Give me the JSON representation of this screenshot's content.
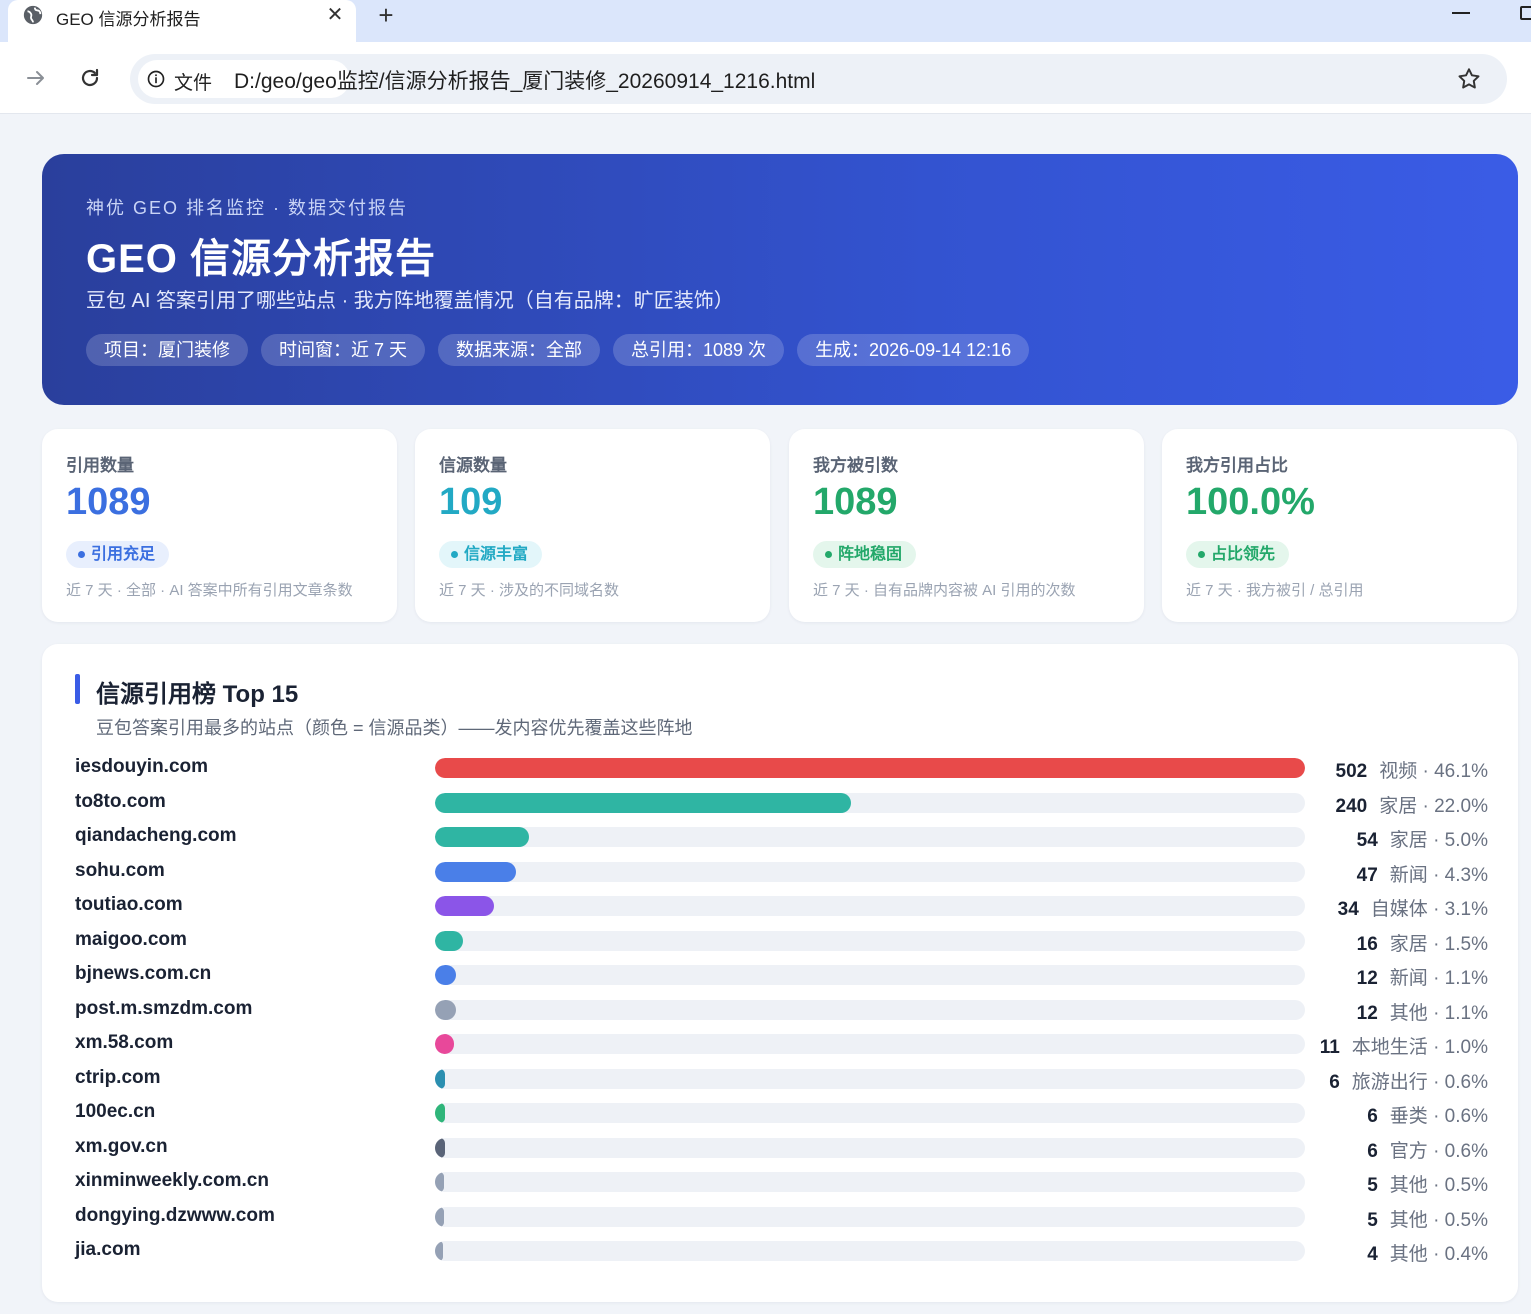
{
  "browser": {
    "tab_title": "GEO 信源分析报告",
    "chip_label": "文件",
    "url": "D:/geo/geo监控/信源分析报告_厦门装修_20260914_1216.html",
    "close_glyph": "✕",
    "newtab_glyph": "+"
  },
  "hero": {
    "eyebrow": "神优 GEO 排名监控 · 数据交付报告",
    "title": "GEO 信源分析报告",
    "subtitle": "豆包 AI 答案引用了哪些站点 · 我方阵地覆盖情况（自有品牌：旷匠装饰）",
    "pills": [
      "项目：厦门装修",
      "时间窗：近 7 天",
      "数据来源：全部",
      "总引用：1089 次",
      "生成：2026-09-14 12:16"
    ]
  },
  "kpis": [
    {
      "label": "引用数量",
      "value": "1089",
      "badge": "引用充足",
      "note": "近 7 天 · 全部 · AI 答案中所有引用文章条数",
      "color": "#3b6fe0",
      "badge_bg": "#e8effd"
    },
    {
      "label": "信源数量",
      "value": "109",
      "badge": "信源丰富",
      "note": "近 7 天 · 涉及的不同域名数",
      "color": "#22a9c4",
      "badge_bg": "#e3f6fa"
    },
    {
      "label": "我方被引数",
      "value": "1089",
      "badge": "阵地稳固",
      "note": "近 7 天 · 自有品牌内容被 AI 引用的次数",
      "color": "#23a86a",
      "badge_bg": "#e4f6ec"
    },
    {
      "label": "我方引用占比",
      "value": "100.0%",
      "badge": "占比领先",
      "note": "近 7 天 · 我方被引 / 总引用",
      "color": "#23a86a",
      "badge_bg": "#e4f6ec"
    }
  ],
  "ranking": {
    "title": "信源引用榜 Top 15",
    "subtitle": "豆包答案引用最多的站点（颜色 = 信源品类）——发内容优先覆盖这些阵地",
    "rows": [
      {
        "domain": "iesdouyin.com",
        "count": "502",
        "category": "视频 · 46.1%",
        "value": 502,
        "color": "#e84a4a"
      },
      {
        "domain": "to8to.com",
        "count": "240",
        "category": "家居 · 22.0%",
        "value": 240,
        "color": "#2fb5a3"
      },
      {
        "domain": "qiandacheng.com",
        "count": "54",
        "category": "家居 · 5.0%",
        "value": 54,
        "color": "#2fb5a3"
      },
      {
        "domain": "sohu.com",
        "count": "47",
        "category": "新闻 · 4.3%",
        "value": 47,
        "color": "#4a7fe8"
      },
      {
        "domain": "toutiao.com",
        "count": "34",
        "category": "自媒体 · 3.1%",
        "value": 34,
        "color": "#8b55e8"
      },
      {
        "domain": "maigoo.com",
        "count": "16",
        "category": "家居 · 1.5%",
        "value": 16,
        "color": "#2fb5a3"
      },
      {
        "domain": "bjnews.com.cn",
        "count": "12",
        "category": "新闻 · 1.1%",
        "value": 12,
        "color": "#4a7fe8"
      },
      {
        "domain": "post.m.smzdm.com",
        "count": "12",
        "category": "其他 · 1.1%",
        "value": 12,
        "color": "#95a1b5"
      },
      {
        "domain": "xm.58.com",
        "count": "11",
        "category": "本地生活 · 1.0%",
        "value": 11,
        "color": "#e8489a"
      },
      {
        "domain": "ctrip.com",
        "count": "6",
        "category": "旅游出行 · 0.6%",
        "value": 6,
        "color": "#2b8fb0"
      },
      {
        "domain": "100ec.cn",
        "count": "6",
        "category": "垂类 · 0.6%",
        "value": 6,
        "color": "#2fb57a"
      },
      {
        "domain": "xm.gov.cn",
        "count": "6",
        "category": "官方 · 0.6%",
        "value": 6,
        "color": "#5a6478"
      },
      {
        "domain": "xinminweekly.com.cn",
        "count": "5",
        "category": "其他 · 0.5%",
        "value": 5,
        "color": "#95a1b5"
      },
      {
        "domain": "dongying.dzwww.com",
        "count": "5",
        "category": "其他 · 0.5%",
        "value": 5,
        "color": "#95a1b5"
      },
      {
        "domain": "jia.com",
        "count": "4",
        "category": "其他 · 0.4%",
        "value": 4,
        "color": "#95a1b5"
      }
    ]
  }
}
